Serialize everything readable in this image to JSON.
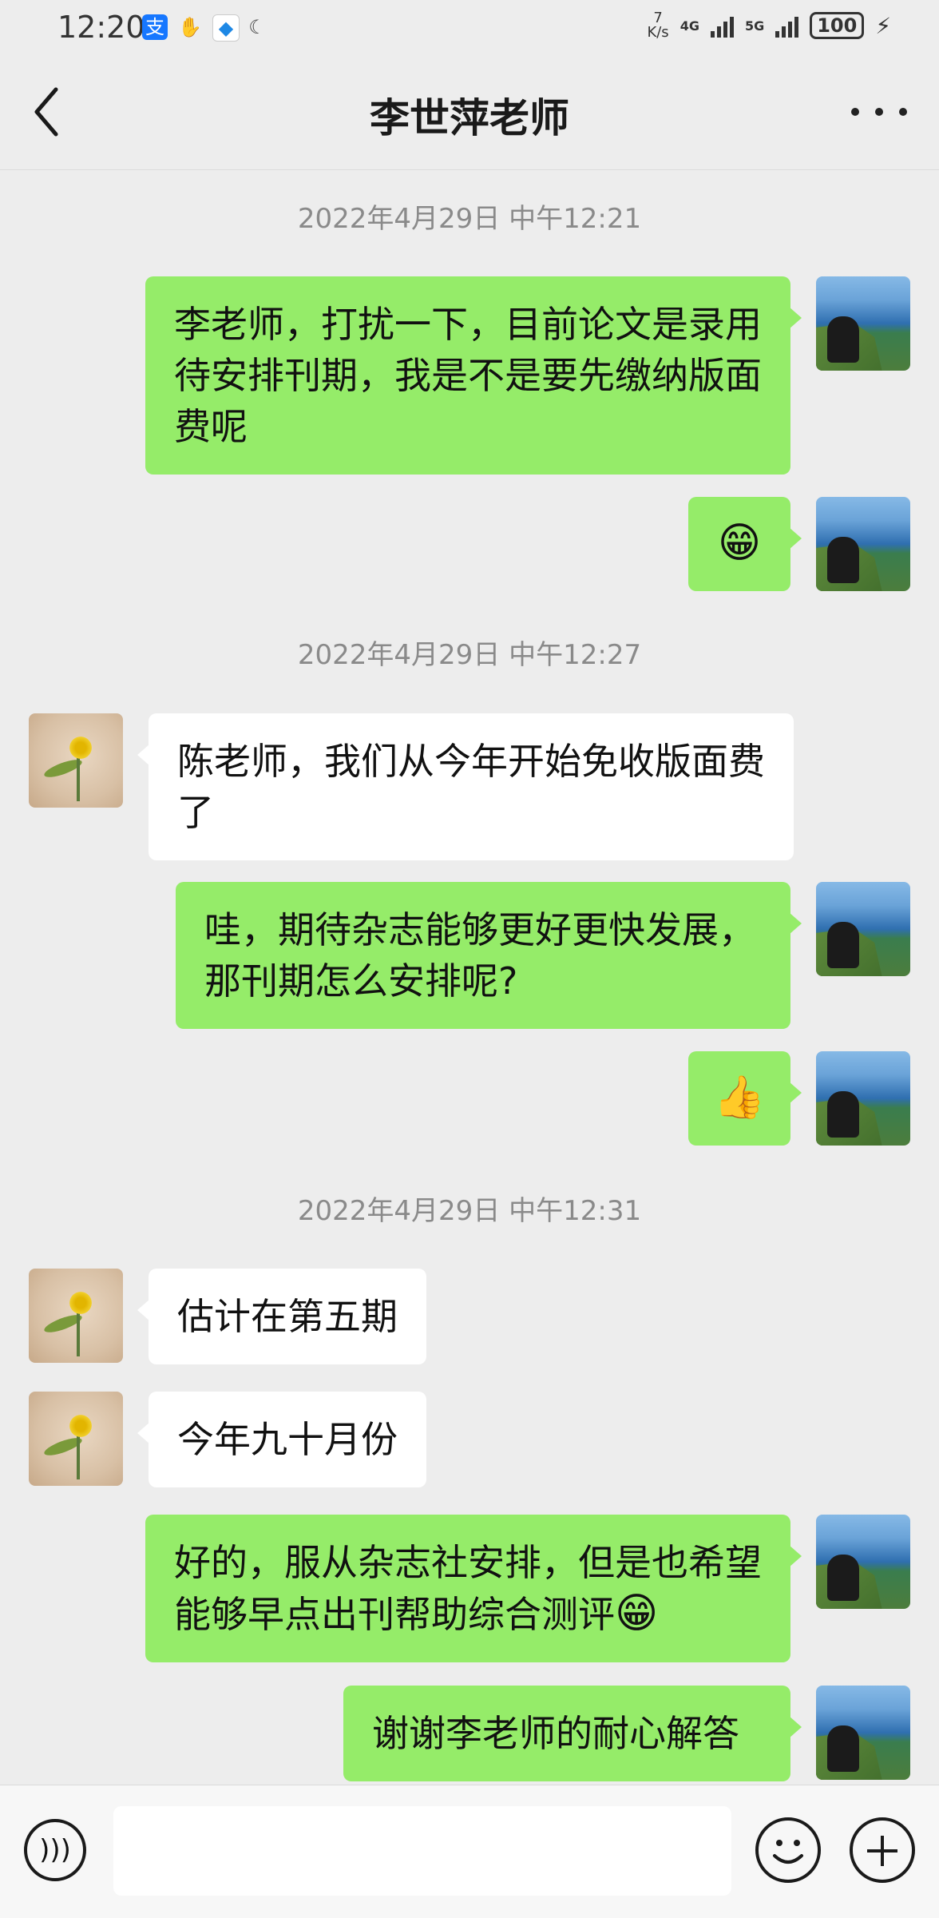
{
  "status_bar": {
    "time": "12:20",
    "net_speed_value": "7",
    "net_speed_unit": "K/s",
    "sim1_label": "4G",
    "sim2_label": "5G",
    "battery": "100"
  },
  "header": {
    "title": "李世萍老师",
    "back_icon": "back-arrow-icon",
    "more_icon": "more-icon"
  },
  "messages": {
    "ts1": "2022年4月29日 中午12:21",
    "m1": "李老师，打扰一下，目前论文是录用待安排刊期，我是不是要先缴纳版面费呢",
    "m2_emoji": "😁",
    "ts2": "2022年4月29日 中午12:27",
    "m3": "陈老师，我们从今年开始免收版面费了",
    "m4": "哇，期待杂志能够更好更快发展，那刊期怎么安排呢?",
    "m5_emoji": "👍",
    "ts3": "2022年4月29日 中午12:31",
    "m6": "估计在第五期",
    "m7": "今年九十月份",
    "m8_text": "好的，服从杂志社安排，但是也希望能够早点出刊帮助综合测评",
    "m8_emoji": "😁",
    "m9": "谢谢李老师的耐心解答"
  },
  "input_bar": {
    "voice_icon": "voice-icon",
    "emoji_icon": "emoji-icon",
    "plus_icon": "plus-icon",
    "input_value": ""
  },
  "colors": {
    "my_bubble": "#95ec69",
    "their_bubble": "#ffffff",
    "background": "#ededed"
  }
}
